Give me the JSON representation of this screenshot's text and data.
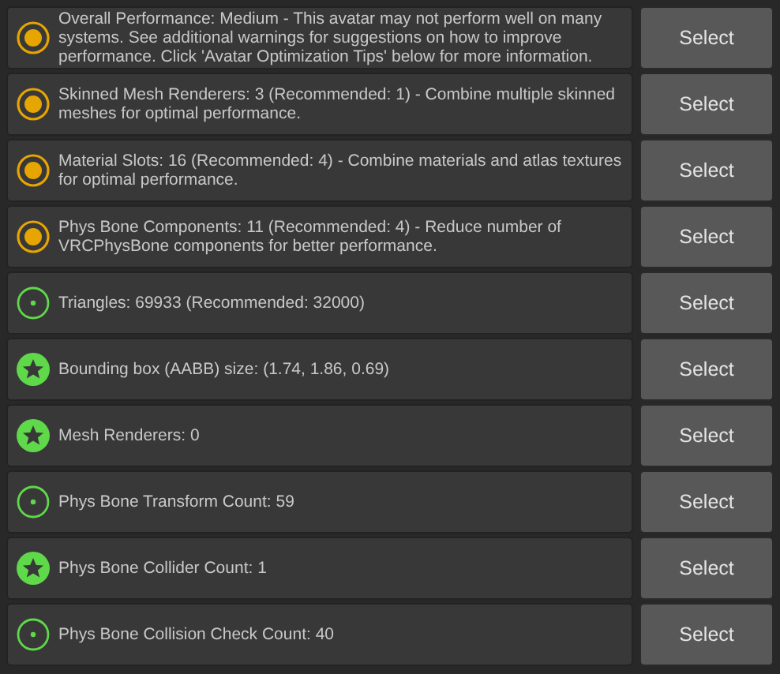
{
  "rows": [
    {
      "kind": "medium",
      "message": "Overall Performance: Medium - This avatar may not perform well on many systems. See additional warnings for suggestions on how to improve performance. Click 'Avatar Optimization Tips' below for more information.",
      "button": "Select"
    },
    {
      "kind": "medium",
      "message": "Skinned Mesh Renderers: 3 (Recommended: 1) - Combine multiple skinned meshes for optimal performance.",
      "button": "Select"
    },
    {
      "kind": "medium",
      "message": "Material Slots: 16 (Recommended: 4) - Combine materials and atlas textures for optimal performance.",
      "button": "Select"
    },
    {
      "kind": "medium",
      "message": "Phys Bone Components: 11 (Recommended: 4) - Reduce number of VRCPhysBone components for better performance.",
      "button": "Select"
    },
    {
      "kind": "good",
      "message": "Triangles: 69933 (Recommended: 32000)",
      "button": "Select"
    },
    {
      "kind": "excellent",
      "message": "Bounding box (AABB) size: (1.74, 1.86, 0.69)",
      "button": "Select"
    },
    {
      "kind": "excellent",
      "message": "Mesh Renderers: 0",
      "button": "Select"
    },
    {
      "kind": "good",
      "message": "Phys Bone Transform Count: 59",
      "button": "Select"
    },
    {
      "kind": "excellent",
      "message": "Phys Bone Collider Count: 1",
      "button": "Select"
    },
    {
      "kind": "good",
      "message": "Phys Bone Collision Check Count: 40",
      "button": "Select"
    }
  ]
}
